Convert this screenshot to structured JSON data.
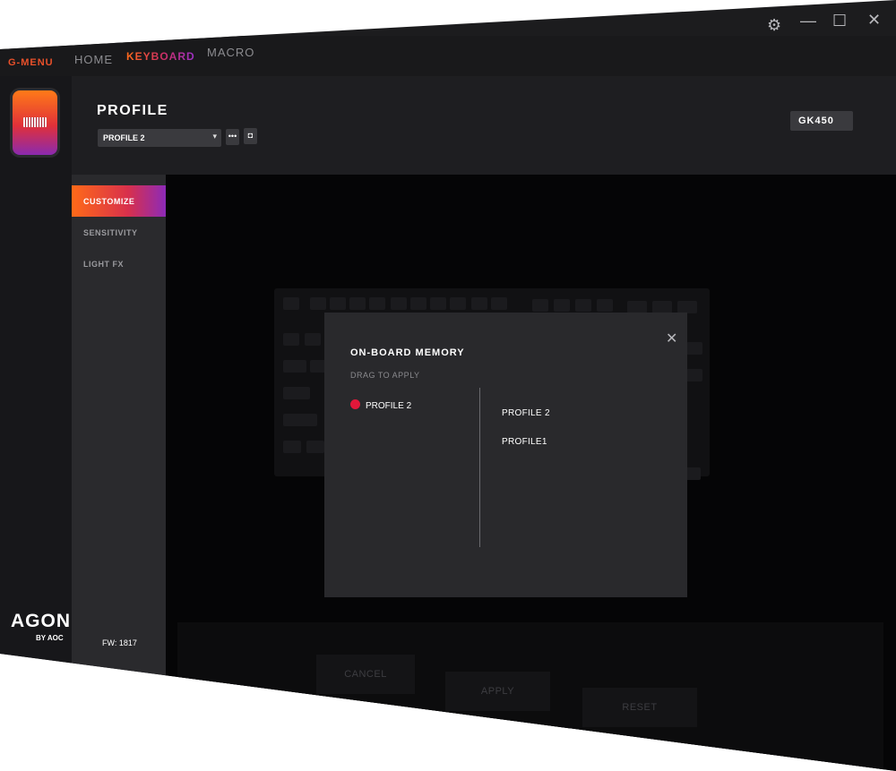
{
  "nav": {
    "brand": "G-MENU",
    "items": [
      {
        "label": "HOME"
      },
      {
        "label": "KEYBOARD",
        "active": true
      },
      {
        "label": "MACRO"
      }
    ]
  },
  "window_controls": {
    "settings_icon": "gear-icon",
    "minimize_icon": "minimize-icon",
    "maximize_icon": "maximize-icon",
    "close_icon": "close-icon",
    "settings": "⚙",
    "minimize": "—",
    "maximize": "☐",
    "close": "✕"
  },
  "header": {
    "title": "PROFILE",
    "profile_select_value": "PROFILE 2",
    "caret": "▾",
    "more_label": "•••",
    "onboard_icon": "◘",
    "model": "GK450"
  },
  "sidebar": {
    "items": [
      {
        "label": "CUSTOMIZE",
        "active": true
      },
      {
        "label": "SENSITIVITY"
      },
      {
        "label": "LIGHT FX"
      }
    ],
    "firmware": "FW: 1817"
  },
  "brand_logo": {
    "name": "AGON",
    "by": "BY AOC"
  },
  "bottom_buttons": {
    "cancel": "CANCEL",
    "apply": "APPLY",
    "reset": "RESET"
  },
  "modal": {
    "title": "ON-BOARD MEMORY",
    "subtitle": "DRAG TO APPLY",
    "close": "✕",
    "memory_slot": "PROFILE 2",
    "profiles": [
      "PROFILE 2",
      "PROFILE1"
    ]
  },
  "colors": {
    "accent_orange": "#ff6a18",
    "accent_purple": "#8d2ab8",
    "slot_dot": "#e3183a",
    "background": "#1c1c1e"
  }
}
